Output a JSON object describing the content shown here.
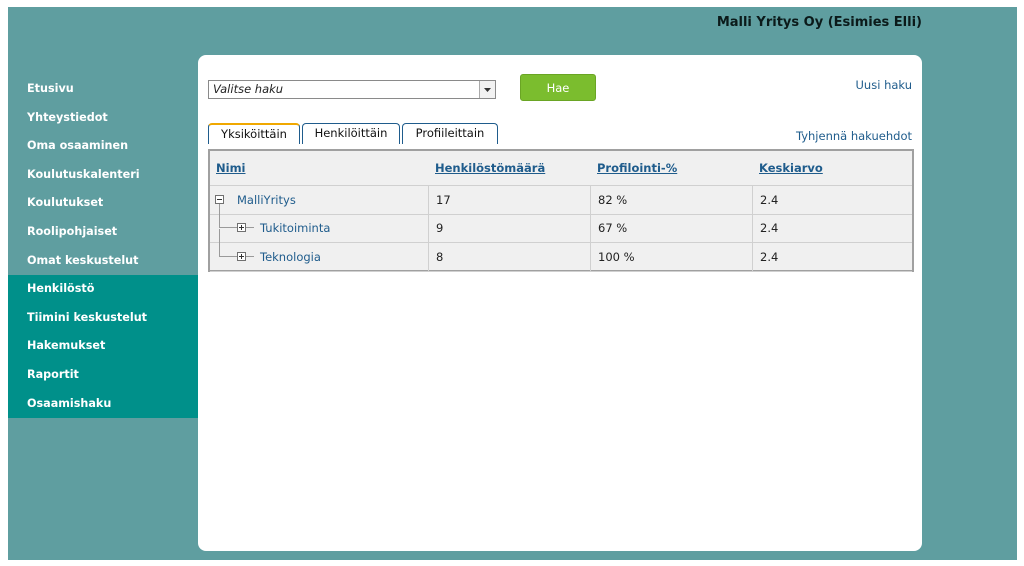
{
  "header": {
    "user": "Malli Yritys Oy (Esimies Elli)"
  },
  "sidebar": {
    "items": [
      {
        "label": "Etusivu"
      },
      {
        "label": "Yhteystiedot"
      },
      {
        "label": "Oma osaaminen"
      },
      {
        "label": "Koulutuskalenteri"
      },
      {
        "label": "Koulutukset"
      },
      {
        "label": "Roolipohjaiset"
      },
      {
        "label": "Omat keskustelut"
      },
      {
        "label": "Henkilöstö"
      },
      {
        "label": "Tiimini keskustelut"
      },
      {
        "label": "Hakemukset"
      },
      {
        "label": "Raportit"
      },
      {
        "label": "Osaamishaku"
      }
    ],
    "colors": {
      "light": "#5f9ea0",
      "dark": "#00908a"
    }
  },
  "search": {
    "select_value": "Valitse haku",
    "button": "Hae",
    "new_search": "Uusi haku",
    "clear": "Tyhjennä hakuehdot"
  },
  "tabs": [
    "Yksiköittäin",
    "Henkilöittäin",
    "Profiileittain"
  ],
  "grid": {
    "headers": [
      "Nimi",
      "Henkilöstömäärä",
      "Profilointi-%",
      "Keskiarvo"
    ],
    "rows": [
      {
        "name": "MalliYritys",
        "count": "17",
        "pct": "82 %",
        "avg": "2.4",
        "expanded": true
      },
      {
        "name": "Tukitoiminta",
        "count": "9",
        "pct": "67 %",
        "avg": "2.4",
        "expanded": false
      },
      {
        "name": "Teknologia",
        "count": "8",
        "pct": "100 %",
        "avg": "2.4",
        "expanded": false
      }
    ]
  },
  "accent": {
    "button": "#7bbd2e",
    "link": "#1f5c8c",
    "active_tab": "#f0a800"
  }
}
